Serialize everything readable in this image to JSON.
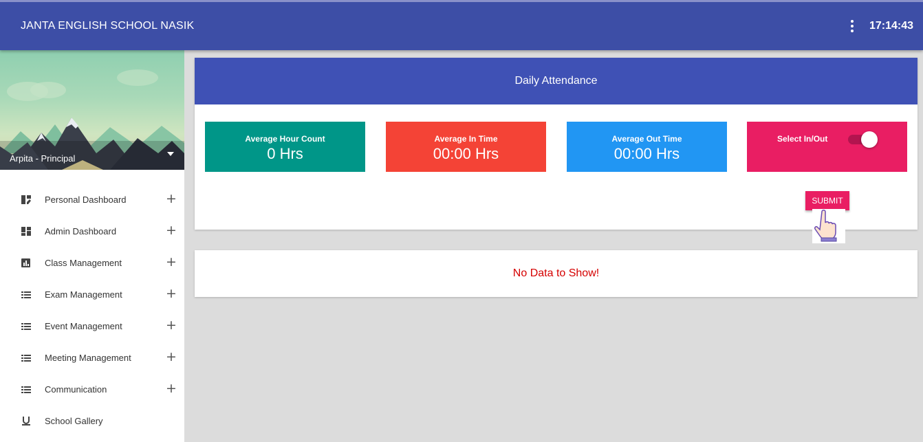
{
  "header": {
    "school_name": "JANTA ENGLISH SCHOOL NASIK",
    "clock": "17:14:43",
    "more_icon": "vertical-dots-icon"
  },
  "profile": {
    "user_label": "Arpita - Principal"
  },
  "sidebar": {
    "items": [
      {
        "label": "Personal Dashboard",
        "icon": "dashboard-edit-icon",
        "expandable": true
      },
      {
        "label": "Admin Dashboard",
        "icon": "dashboard-icon",
        "expandable": true
      },
      {
        "label": "Class Management",
        "icon": "bar-chart-icon",
        "expandable": true
      },
      {
        "label": "Exam Management",
        "icon": "list-icon",
        "expandable": true
      },
      {
        "label": "Event Management",
        "icon": "list-icon",
        "expandable": true
      },
      {
        "label": "Meeting Management",
        "icon": "list-icon",
        "expandable": true
      },
      {
        "label": "Communication",
        "icon": "list-icon",
        "expandable": true
      },
      {
        "label": "School Gallery",
        "icon": "underline-icon",
        "expandable": false
      }
    ],
    "expand_symbol": "+"
  },
  "attendance": {
    "title": "Daily Attendance",
    "stats": [
      {
        "label": "Average Hour Count",
        "value": "0 Hrs",
        "color": "#009688"
      },
      {
        "label": "Average In Time",
        "value": "00:00 Hrs",
        "color": "#f44336"
      },
      {
        "label": "Average Out Time",
        "value": "00:00 Hrs",
        "color": "#2196f3"
      }
    ],
    "toggle": {
      "label": "Select In/Out",
      "color": "#e91e63",
      "on": true
    },
    "submit_label": "SUBMIT"
  },
  "results": {
    "empty_message": "No Data to Show!"
  },
  "colors": {
    "header": "#3d4ea6",
    "card_header": "#3f51b5",
    "empty_text": "#d50000"
  }
}
